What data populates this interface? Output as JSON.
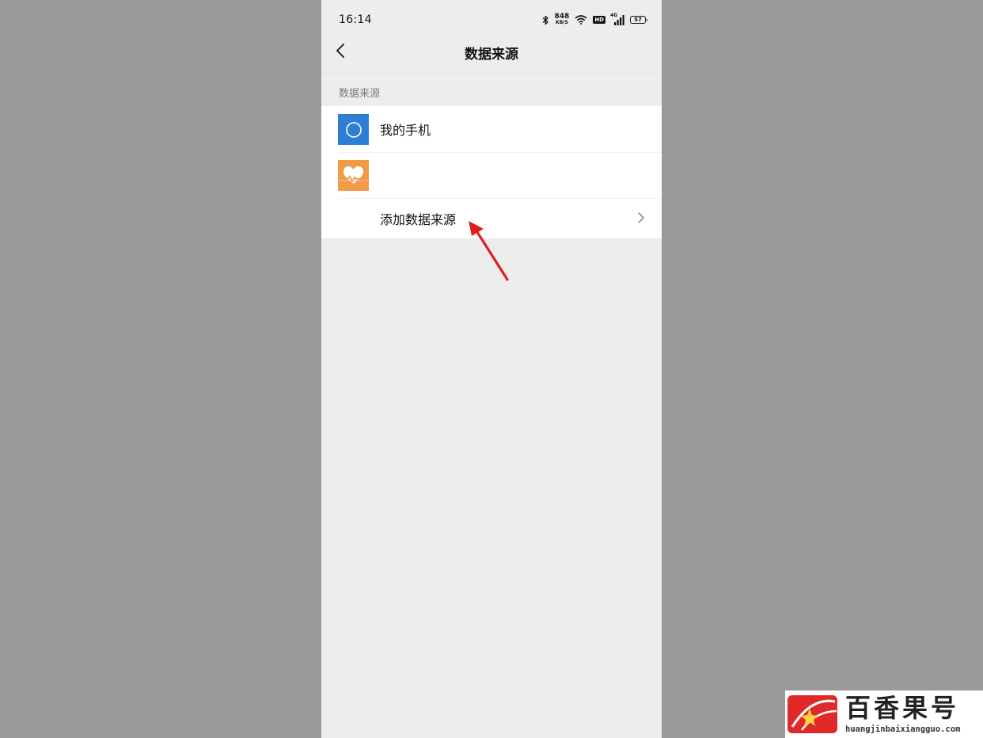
{
  "status_bar": {
    "time": "16:14",
    "net_speed_value": "848",
    "net_speed_unit": "KB/S",
    "hd": "HD",
    "signal_type": "4G",
    "battery": "57"
  },
  "nav": {
    "title": "数据来源",
    "back_icon": "chevron-left-icon"
  },
  "section": {
    "label": "数据来源"
  },
  "list": {
    "items": [
      {
        "label": "我的手机",
        "icon": "phone-source-icon",
        "icon_color": "#2d7fd6"
      },
      {
        "label": "",
        "icon": "health-heart-icon",
        "icon_color": "#f19a48"
      },
      {
        "label": "添加数据来源",
        "icon": "chevron-right-icon"
      }
    ]
  },
  "annotation": {
    "arrow_color": "#e01e1e"
  },
  "watermark": {
    "text": "百香果号",
    "url": "huangjinbaixiangguo.com",
    "logo_color": "#e02a2a"
  }
}
